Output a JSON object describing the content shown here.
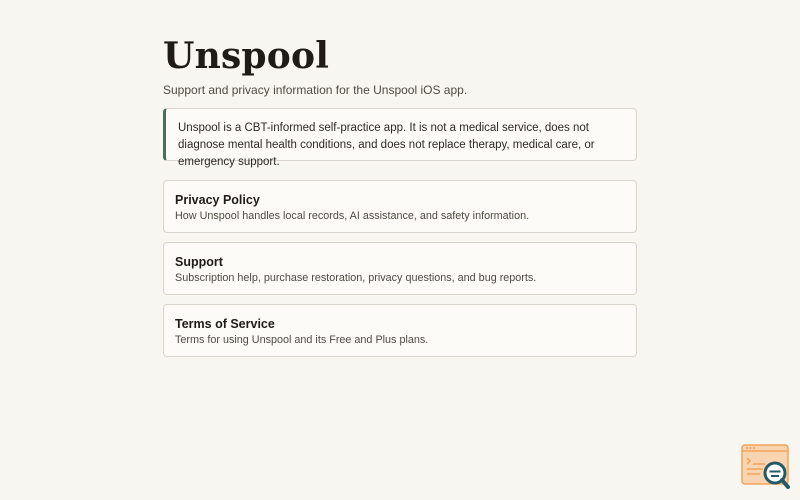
{
  "header": {
    "title": "Unspool",
    "subtitle": "Support and privacy information for the Unspool iOS app."
  },
  "notice": {
    "text": "Unspool is a CBT-informed self-practice app. It is not a medical service, does not diagnose mental health conditions, and does not replace therapy, medical care, or emergency support."
  },
  "links": [
    {
      "title": "Privacy Policy",
      "description": "How Unspool handles local records, AI assistance, and safety information."
    },
    {
      "title": "Support",
      "description": "Subscription help, purchase restoration, privacy questions, and bug reports."
    },
    {
      "title": "Terms of Service",
      "description": "Terms for using Unspool and its Free and Plus plans."
    }
  ],
  "badge": {
    "icon": "page-search-icon"
  },
  "colors": {
    "background": "#f8f6f1",
    "card": "#fcfbf8",
    "border": "#d9d5cc",
    "accent": "#4f6b5c",
    "badge": "#f3a35a",
    "badge_dark": "#215a66"
  }
}
